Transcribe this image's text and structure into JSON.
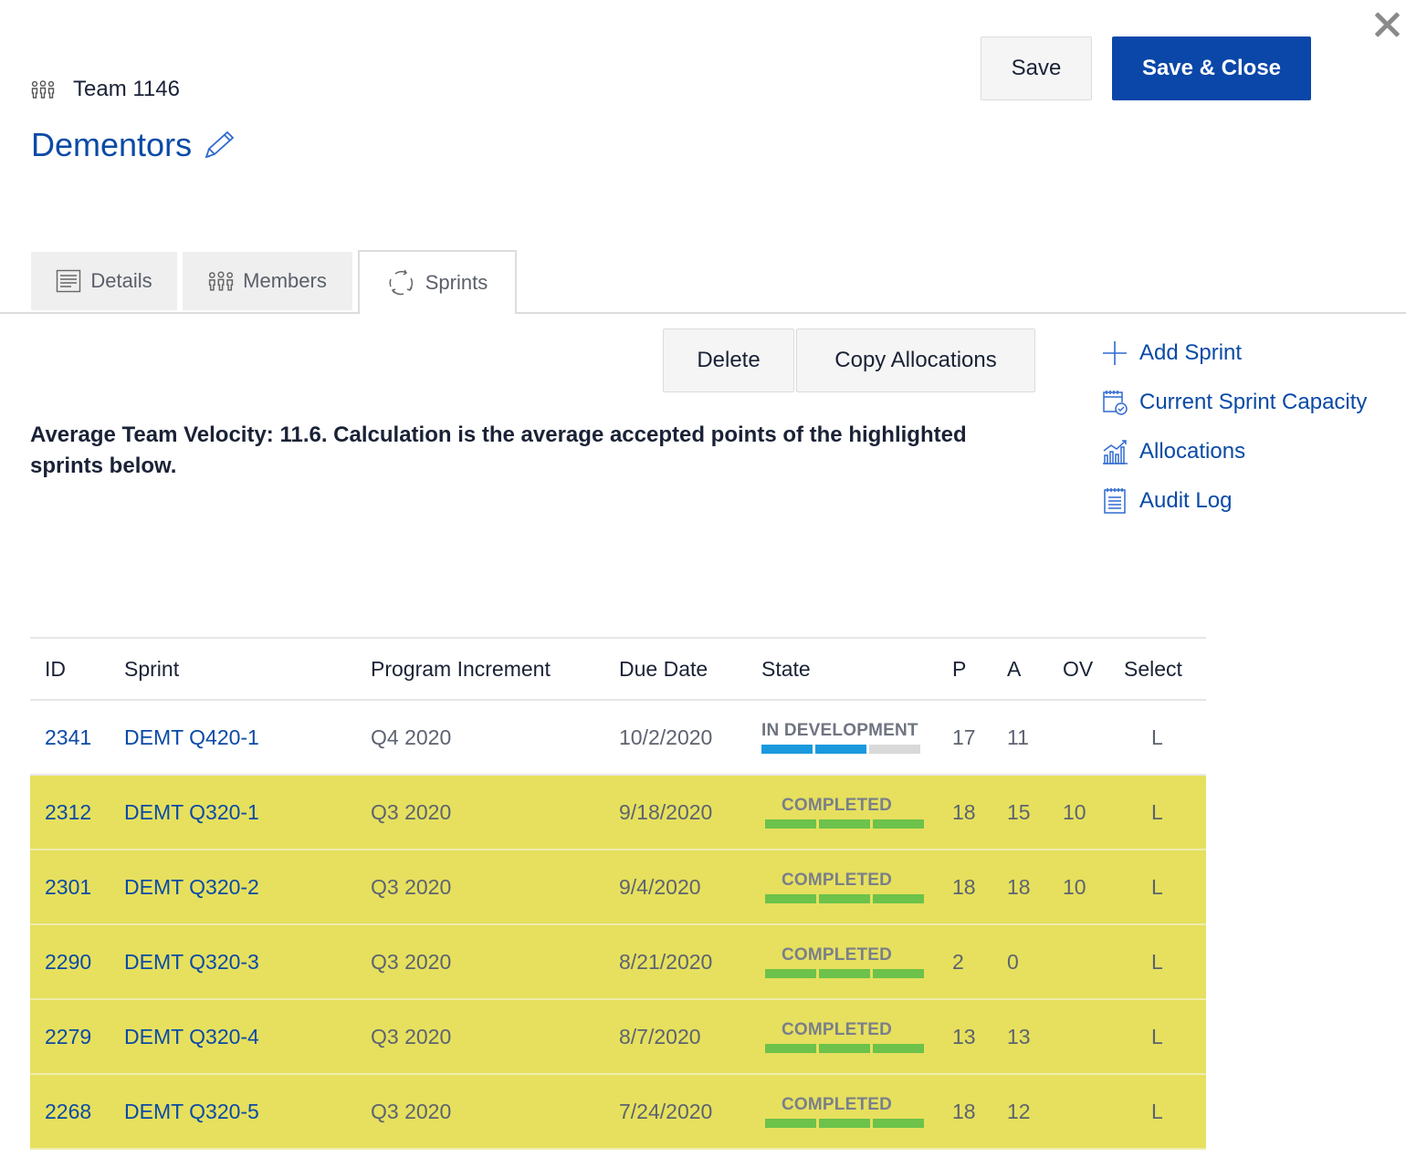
{
  "header": {
    "team_label": "Team 1146",
    "team_name": "Dementors",
    "save_label": "Save",
    "save_close_label": "Save & Close"
  },
  "tabs": [
    {
      "label": "Details"
    },
    {
      "label": "Members"
    },
    {
      "label": "Sprints"
    }
  ],
  "actions": {
    "delete_label": "Delete",
    "copy_allocations_label": "Copy Allocations"
  },
  "velocity_text": "Average Team Velocity: 11.6. Calculation is the average accepted points of the highlighted sprints below.",
  "side_links": [
    {
      "label": "Add Sprint",
      "icon": "plus-icon"
    },
    {
      "label": "Current Sprint Capacity",
      "icon": "calendar-check-icon"
    },
    {
      "label": "Allocations",
      "icon": "bar-chart-icon"
    },
    {
      "label": "Audit Log",
      "icon": "notepad-icon"
    }
  ],
  "table": {
    "columns": [
      "ID",
      "Sprint",
      "Program Increment",
      "Due Date",
      "State",
      "P",
      "A",
      "OV",
      "Select"
    ],
    "rows": [
      {
        "id": "2341",
        "sprint": "DEMT Q420-1",
        "pi": "Q4 2020",
        "due": "10/2/2020",
        "state": "IN DEVELOPMENT",
        "p": "17",
        "a": "11",
        "ov": "",
        "select": "L"
      },
      {
        "id": "2312",
        "sprint": "DEMT Q320-1",
        "pi": "Q3 2020",
        "due": "9/18/2020",
        "state": "COMPLETED",
        "p": "18",
        "a": "15",
        "ov": "10",
        "select": "L"
      },
      {
        "id": "2301",
        "sprint": "DEMT Q320-2",
        "pi": "Q3 2020",
        "due": "9/4/2020",
        "state": "COMPLETED",
        "p": "18",
        "a": "18",
        "ov": "10",
        "select": "L"
      },
      {
        "id": "2290",
        "sprint": "DEMT Q320-3",
        "pi": "Q3 2020",
        "due": "8/21/2020",
        "state": "COMPLETED",
        "p": "2",
        "a": "0",
        "ov": "",
        "select": "L"
      },
      {
        "id": "2279",
        "sprint": "DEMT Q320-4",
        "pi": "Q3 2020",
        "due": "8/7/2020",
        "state": "COMPLETED",
        "p": "13",
        "a": "13",
        "ov": "",
        "select": "L"
      },
      {
        "id": "2268",
        "sprint": "DEMT Q320-5",
        "pi": "Q3 2020",
        "due": "7/24/2020",
        "state": "COMPLETED",
        "p": "18",
        "a": "12",
        "ov": "",
        "select": "L"
      }
    ]
  },
  "colors": {
    "primary": "#0a47a9",
    "link": "#0a4aa6",
    "highlight_row": "#e6e05e",
    "progress_dev": "#1a99dd",
    "progress_done": "#6cc24a"
  }
}
